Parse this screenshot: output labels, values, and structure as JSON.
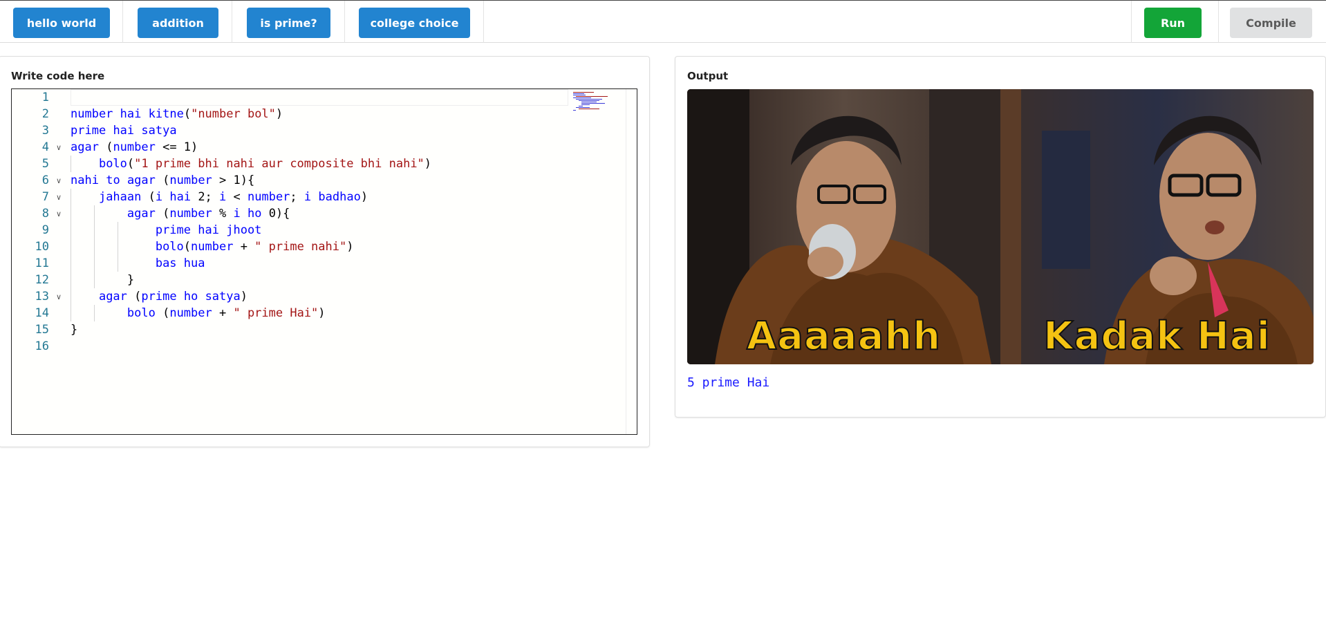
{
  "toolbar": {
    "examples": [
      "hello world",
      "addition",
      "is prime?",
      "college choice"
    ],
    "run_label": "Run",
    "compile_label": "Compile"
  },
  "editor": {
    "title": "Write code here",
    "line_numbers": [
      "1",
      "2",
      "3",
      "4",
      "5",
      "6",
      "7",
      "8",
      "9",
      "10",
      "11",
      "12",
      "13",
      "14",
      "15",
      "16"
    ],
    "code_lines": [
      "",
      "number hai kitne(\"number bol\")",
      "prime hai satya",
      "agar (number <= 1)",
      "    bolo(\"1 prime bhi nahi aur composite bhi nahi\")",
      "nahi to agar (number > 1){",
      "    jahaan (i hai 2; i < number; i badhao)",
      "        agar (number % i ho 0){",
      "            prime hai jhoot",
      "            bolo(number + \" prime nahi\")",
      "            bas hua",
      "        }",
      "    agar (prime ho satya)",
      "        bolo (number + \" prime Hai\")",
      "}",
      ""
    ],
    "fold_lines": [
      4,
      6,
      7,
      8,
      13
    ]
  },
  "output": {
    "title": "Output",
    "meme_left_caption": "Aaaaahh",
    "meme_right_caption": "Kadak Hai",
    "result_text": "5 prime Hai"
  },
  "colors": {
    "primary_blue": "#2284d0",
    "run_green": "#13a538",
    "compile_grey": "#e0e1e2",
    "keyword_blue": "#0000ff",
    "string_red": "#a31515",
    "line_number": "#237893",
    "output_text": "#1a1aff",
    "meme_caption": "#f5c312"
  }
}
